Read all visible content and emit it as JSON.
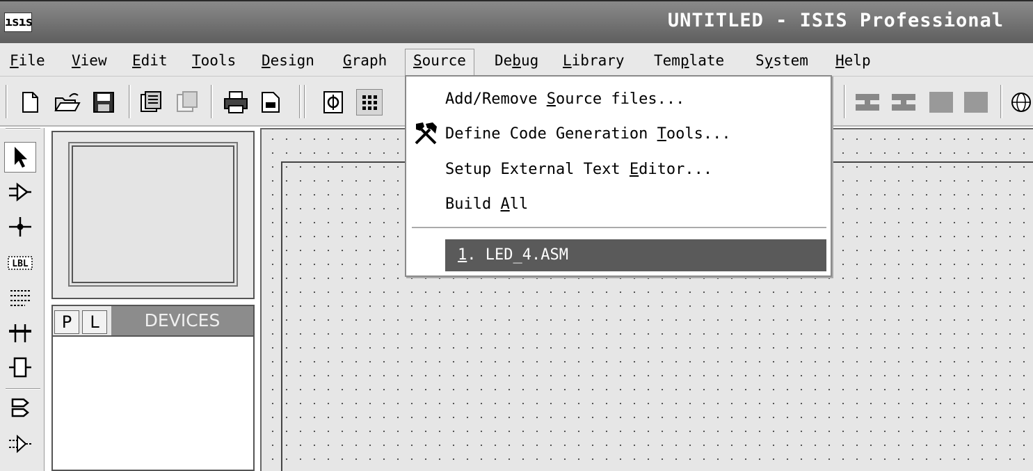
{
  "window": {
    "app_icon_text": "ısıs",
    "title": "UNTITLED - ISIS Professional"
  },
  "menubar": {
    "items": [
      {
        "label": "File",
        "ul": "F",
        "rest": "ile"
      },
      {
        "label": "View",
        "ul": "V",
        "rest": "iew"
      },
      {
        "label": "Edit",
        "ul": "E",
        "rest": "dit"
      },
      {
        "label": "Tools",
        "ul": "T",
        "rest": "ools"
      },
      {
        "label": "Design",
        "ul": "D",
        "rest": "esign"
      },
      {
        "label": "Graph",
        "ul": "G",
        "rest": "raph"
      },
      {
        "label": "Source",
        "ul": "S",
        "rest": "ource"
      },
      {
        "label": "Debug",
        "pre": "De",
        "ul": "b",
        "rest": "ug"
      },
      {
        "label": "Library",
        "ul": "L",
        "rest": "ibrary"
      },
      {
        "label": "Template",
        "pre": "Tem",
        "ul": "p",
        "rest": "late"
      },
      {
        "label": "System",
        "pre": "S",
        "ul": "y",
        "rest": "stem"
      },
      {
        "label": "Help",
        "ul": "H",
        "rest": "elp"
      }
    ],
    "open_menu": "Source"
  },
  "source_menu": {
    "item1": {
      "pre": "Add/Remove ",
      "ul": "S",
      "rest": "ource files..."
    },
    "item2": {
      "pre": "Define Code Generation ",
      "ul": "T",
      "rest": "ools..."
    },
    "item3": {
      "pre": "Setup External Text ",
      "ul": "E",
      "rest": "ditor..."
    },
    "item4": {
      "pre": "Build ",
      "ul": "A",
      "rest": "ll"
    },
    "recent": {
      "ul": "1",
      "rest": ". LED_4.ASM"
    }
  },
  "devices_panel": {
    "tab_p": "P",
    "tab_l": "L",
    "title": "DEVICES"
  },
  "icons": {
    "toolbar": [
      "new-file-icon",
      "open-folder-icon",
      "save-disk-icon",
      "import-icon",
      "export-icon",
      "print-icon",
      "page-setup-icon",
      "refresh-icon",
      "grid-icon"
    ],
    "palette": [
      "select-arrow-icon",
      "component-icon",
      "junction-dot-icon",
      "wire-label-icon",
      "text-script-icon",
      "bus-icon",
      "subcircuit-icon",
      "terminal-icon",
      "device-pin-icon"
    ]
  }
}
